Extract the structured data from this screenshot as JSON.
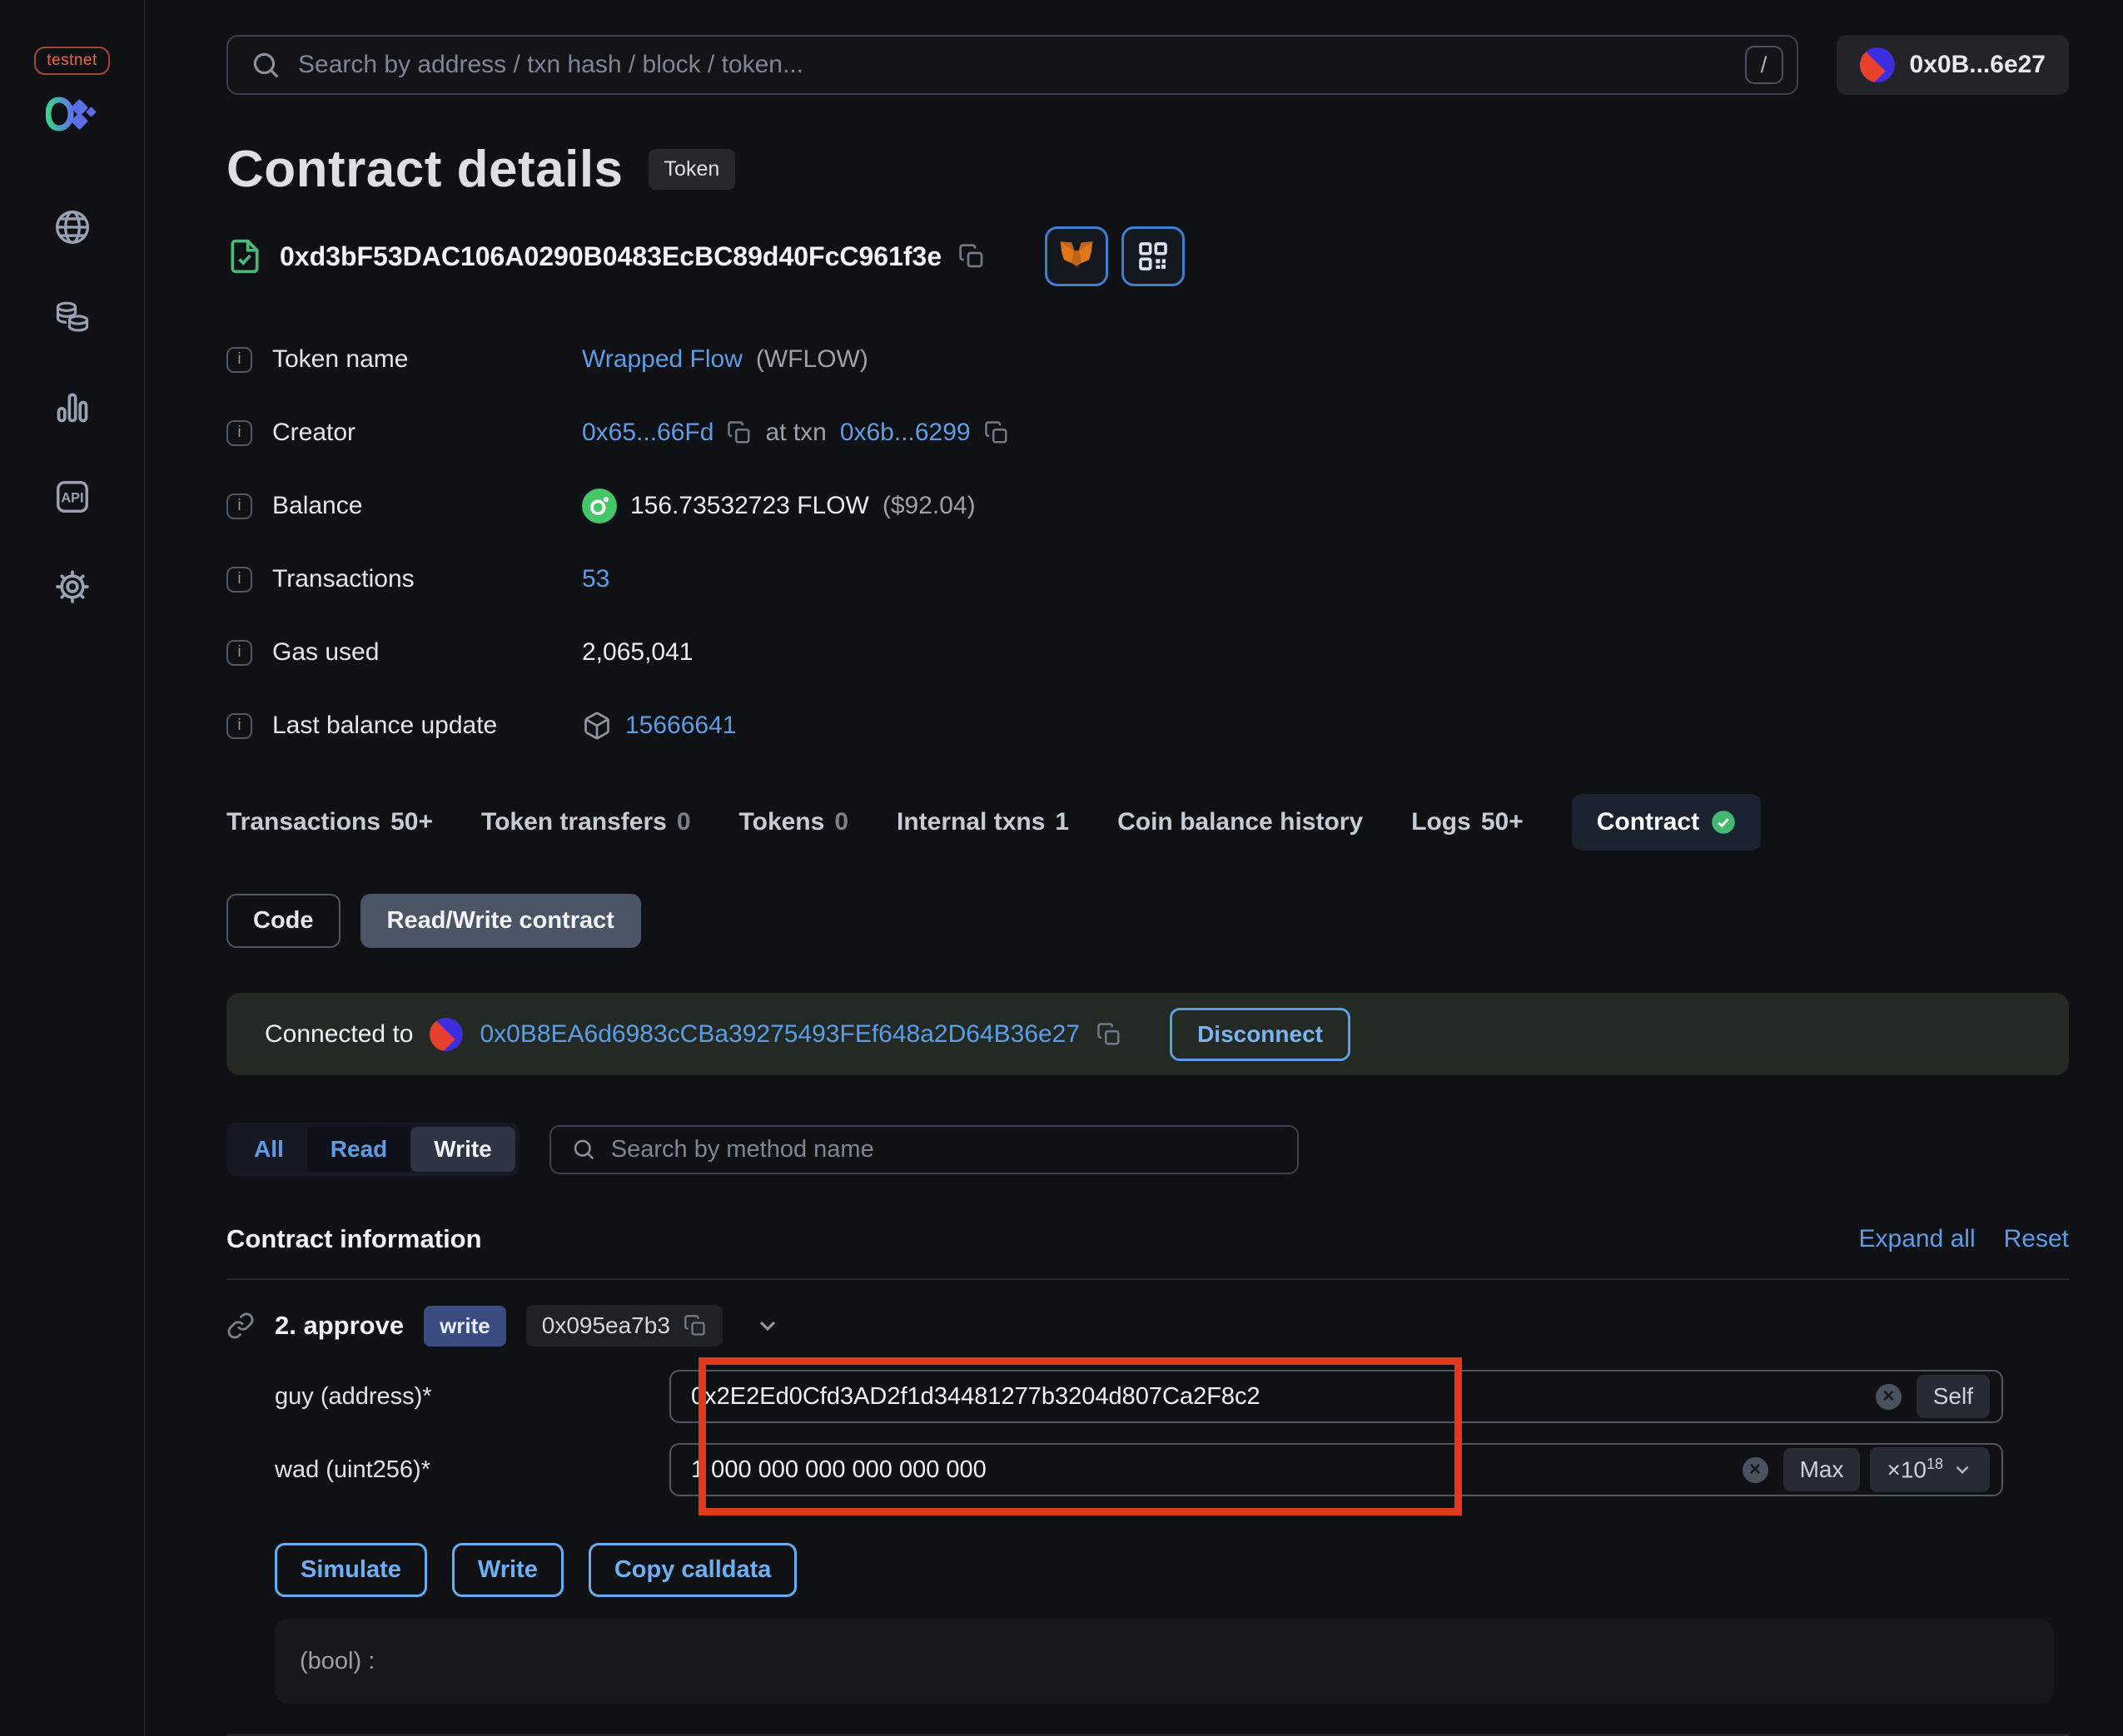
{
  "colors": {
    "link_blue": "#5d9ce6",
    "action_blue": "#6cb0f5",
    "success_green": "#43b871",
    "annotation_red": "#e03a1a",
    "metamask_orange": "#e2761b"
  },
  "sidebar": {
    "network_badge": "testnet"
  },
  "header": {
    "search_placeholder": "Search by address / txn hash / block / token...",
    "search_shortcut": "/",
    "wallet_label": "0x0B...6e27"
  },
  "page": {
    "title": "Contract details",
    "type_badge": "Token",
    "contract_address": "0xd3bF53DAC106A0290B0483EcBC89d40FcC961f3e"
  },
  "info": {
    "rows": [
      {
        "label": "Token name",
        "link": "Wrapped Flow",
        "suffix": "(WFLOW)"
      },
      {
        "label": "Creator",
        "link": "0x65...66Fd",
        "mid": "at txn",
        "link2": "0x6b...6299"
      },
      {
        "label": "Balance",
        "value": "156.73532723 FLOW",
        "suffix": "($92.04)"
      },
      {
        "label": "Transactions",
        "link": "53"
      },
      {
        "label": "Gas used",
        "value": "2,065,041"
      },
      {
        "label": "Last balance update",
        "link": "15666641"
      }
    ]
  },
  "tabs": [
    {
      "label": "Transactions",
      "count": "50+"
    },
    {
      "label": "Token transfers",
      "count": "0"
    },
    {
      "label": "Tokens",
      "count": "0"
    },
    {
      "label": "Internal txns",
      "count": "1"
    },
    {
      "label": "Coin balance history",
      "count": ""
    },
    {
      "label": "Logs",
      "count": "50+"
    },
    {
      "label": "Contract",
      "count": ""
    }
  ],
  "subtabs": {
    "code": "Code",
    "read_write": "Read/Write contract"
  },
  "connection": {
    "prefix": "Connected to",
    "address": "0x0B8EA6d6983cCBa39275493FEf648a2D64B36e27",
    "disconnect_label": "Disconnect"
  },
  "filter": {
    "all": "All",
    "read": "Read",
    "write": "Write",
    "search_placeholder": "Search by method name"
  },
  "section": {
    "title": "Contract information",
    "expand_all": "Expand all",
    "reset": "Reset"
  },
  "method": {
    "name": "2. approve",
    "badge": "write",
    "selector": "0x095ea7b3"
  },
  "form": {
    "fields": [
      {
        "label": "guy (address)*",
        "value": "0x2E2Ed0Cfd3AD2f1d34481277b3204d807Ca2F8c2",
        "action": "Self"
      },
      {
        "label": "wad (uint256)*",
        "value": "1 000 000 000 000 000 000",
        "action": "Max",
        "multiplier_base": "×10",
        "multiplier_exp": "18"
      }
    ],
    "buttons": {
      "simulate": "Simulate",
      "write": "Write",
      "copy_calldata": "Copy calldata"
    },
    "output": "(bool) :"
  },
  "icons": {
    "clear": "×",
    "info": "i",
    "api": "API"
  }
}
